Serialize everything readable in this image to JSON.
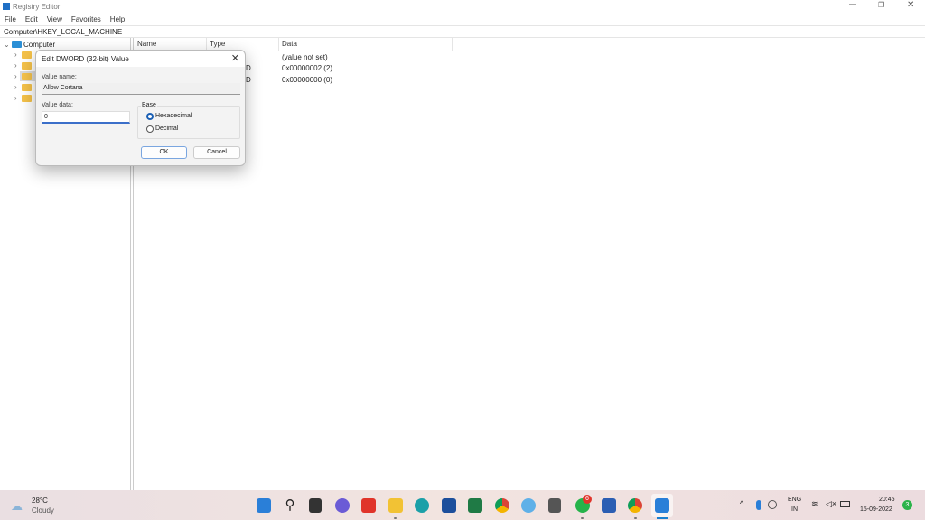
{
  "window": {
    "title": "Registry Editor",
    "menu": [
      "File",
      "Edit",
      "View",
      "Favorites",
      "Help"
    ],
    "address": "Computer\\HKEY_LOCAL_MACHINE"
  },
  "tree": {
    "root": "Computer"
  },
  "list": {
    "columns": [
      "Name",
      "Type",
      "Data"
    ],
    "rows": [
      {
        "type": "",
        "data": "(value not set)"
      },
      {
        "type": "D",
        "data": "0x00000002 (2)"
      },
      {
        "type": "D",
        "data": "0x00000000 (0)"
      }
    ]
  },
  "dialog": {
    "title": "Edit DWORD (32-bit) Value",
    "value_name_label": "Value name:",
    "value_name": "Allow Cortana",
    "value_data_label": "Value data:",
    "value_data": "0",
    "base_label": "Base",
    "options": [
      "Hexadecimal",
      "Decimal"
    ],
    "selected": "Hexadecimal",
    "ok": "OK",
    "cancel": "Cancel"
  },
  "taskbar": {
    "temp": "28°C",
    "weather": "Cloudy",
    "whatsapp_badge": "6",
    "lang": "ENG",
    "region": "IN",
    "time": "20:45",
    "date": "15-09-2022",
    "notif": "3"
  }
}
